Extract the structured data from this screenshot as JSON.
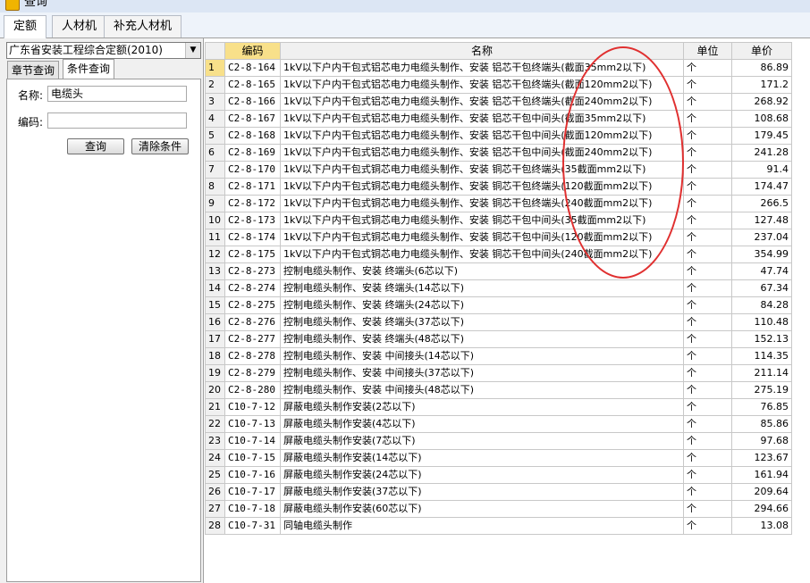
{
  "window": {
    "title": "查询"
  },
  "tabs": [
    {
      "label": "定额"
    },
    {
      "label": "人材机"
    },
    {
      "label": "补充人材机"
    }
  ],
  "left_panel": {
    "quota_library": "广东省安装工程综合定额(2010)",
    "subtabs": [
      {
        "label": "章节查询"
      },
      {
        "label": "条件查询"
      }
    ],
    "name_label": "名称:",
    "name_value": "电缆头",
    "code_label": "编码:",
    "code_value": "",
    "query_button": "查询",
    "clear_button": "清除条件"
  },
  "table": {
    "headers": {
      "code": "编码",
      "name": "名称",
      "unit": "单位",
      "price": "单价"
    },
    "rows": [
      {
        "num": "1",
        "code": "C2-8-164",
        "name": "1kV以下户内干包式铝芯电力电缆头制作、安装 铝芯干包终端头(截面35mm2以下)",
        "unit": "个",
        "price": "86.89"
      },
      {
        "num": "2",
        "code": "C2-8-165",
        "name": "1kV以下户内干包式铝芯电力电缆头制作、安装 铝芯干包终端头(截面120mm2以下)",
        "unit": "个",
        "price": "171.2"
      },
      {
        "num": "3",
        "code": "C2-8-166",
        "name": "1kV以下户内干包式铝芯电力电缆头制作、安装 铝芯干包终端头(截面240mm2以下)",
        "unit": "个",
        "price": "268.92"
      },
      {
        "num": "4",
        "code": "C2-8-167",
        "name": "1kV以下户内干包式铝芯电力电缆头制作、安装 铝芯干包中间头(截面35mm2以下)",
        "unit": "个",
        "price": "108.68"
      },
      {
        "num": "5",
        "code": "C2-8-168",
        "name": "1kV以下户内干包式铝芯电力电缆头制作、安装 铝芯干包中间头(截面120mm2以下)",
        "unit": "个",
        "price": "179.45"
      },
      {
        "num": "6",
        "code": "C2-8-169",
        "name": "1kV以下户内干包式铝芯电力电缆头制作、安装 铝芯干包中间头(截面240mm2以下)",
        "unit": "个",
        "price": "241.28"
      },
      {
        "num": "7",
        "code": "C2-8-170",
        "name": "1kV以下户内干包式铜芯电力电缆头制作、安装 铜芯干包终端头(35截面mm2以下)",
        "unit": "个",
        "price": "91.4"
      },
      {
        "num": "8",
        "code": "C2-8-171",
        "name": "1kV以下户内干包式铜芯电力电缆头制作、安装 铜芯干包终端头(120截面mm2以下)",
        "unit": "个",
        "price": "174.47"
      },
      {
        "num": "9",
        "code": "C2-8-172",
        "name": "1kV以下户内干包式铜芯电力电缆头制作、安装 铜芯干包终端头(240截面mm2以下)",
        "unit": "个",
        "price": "266.5"
      },
      {
        "num": "10",
        "code": "C2-8-173",
        "name": "1kV以下户内干包式铜芯电力电缆头制作、安装 铜芯干包中间头(35截面mm2以下)",
        "unit": "个",
        "price": "127.48"
      },
      {
        "num": "11",
        "code": "C2-8-174",
        "name": "1kV以下户内干包式铜芯电力电缆头制作、安装 铜芯干包中间头(120截面mm2以下)",
        "unit": "个",
        "price": "237.04"
      },
      {
        "num": "12",
        "code": "C2-8-175",
        "name": "1kV以下户内干包式铜芯电力电缆头制作、安装 铜芯干包中间头(240截面mm2以下)",
        "unit": "个",
        "price": "354.99"
      },
      {
        "num": "13",
        "code": "C2-8-273",
        "name": "控制电缆头制作、安装 终端头(6芯以下)",
        "unit": "个",
        "price": "47.74"
      },
      {
        "num": "14",
        "code": "C2-8-274",
        "name": "控制电缆头制作、安装 终端头(14芯以下)",
        "unit": "个",
        "price": "67.34"
      },
      {
        "num": "15",
        "code": "C2-8-275",
        "name": "控制电缆头制作、安装 终端头(24芯以下)",
        "unit": "个",
        "price": "84.28"
      },
      {
        "num": "16",
        "code": "C2-8-276",
        "name": "控制电缆头制作、安装 终端头(37芯以下)",
        "unit": "个",
        "price": "110.48"
      },
      {
        "num": "17",
        "code": "C2-8-277",
        "name": "控制电缆头制作、安装 终端头(48芯以下)",
        "unit": "个",
        "price": "152.13"
      },
      {
        "num": "18",
        "code": "C2-8-278",
        "name": "控制电缆头制作、安装 中间接头(14芯以下)",
        "unit": "个",
        "price": "114.35"
      },
      {
        "num": "19",
        "code": "C2-8-279",
        "name": "控制电缆头制作、安装 中间接头(37芯以下)",
        "unit": "个",
        "price": "211.14"
      },
      {
        "num": "20",
        "code": "C2-8-280",
        "name": "控制电缆头制作、安装 中间接头(48芯以下)",
        "unit": "个",
        "price": "275.19"
      },
      {
        "num": "21",
        "code": "C10-7-12",
        "name": "屏蔽电缆头制作安装(2芯以下)",
        "unit": "个",
        "price": "76.85"
      },
      {
        "num": "22",
        "code": "C10-7-13",
        "name": "屏蔽电缆头制作安装(4芯以下)",
        "unit": "个",
        "price": "85.86"
      },
      {
        "num": "23",
        "code": "C10-7-14",
        "name": "屏蔽电缆头制作安装(7芯以下)",
        "unit": "个",
        "price": "97.68"
      },
      {
        "num": "24",
        "code": "C10-7-15",
        "name": "屏蔽电缆头制作安装(14芯以下)",
        "unit": "个",
        "price": "123.67"
      },
      {
        "num": "25",
        "code": "C10-7-16",
        "name": "屏蔽电缆头制作安装(24芯以下)",
        "unit": "个",
        "price": "161.94"
      },
      {
        "num": "26",
        "code": "C10-7-17",
        "name": "屏蔽电缆头制作安装(37芯以下)",
        "unit": "个",
        "price": "209.64"
      },
      {
        "num": "27",
        "code": "C10-7-18",
        "name": "屏蔽电缆头制作安装(60芯以下)",
        "unit": "个",
        "price": "294.66"
      },
      {
        "num": "28",
        "code": "C10-7-31",
        "name": "同轴电缆头制作",
        "unit": "个",
        "price": "13.08"
      }
    ]
  },
  "colors": {
    "highlight": "#f8e08a",
    "annotation_ellipse": "#e03030"
  }
}
